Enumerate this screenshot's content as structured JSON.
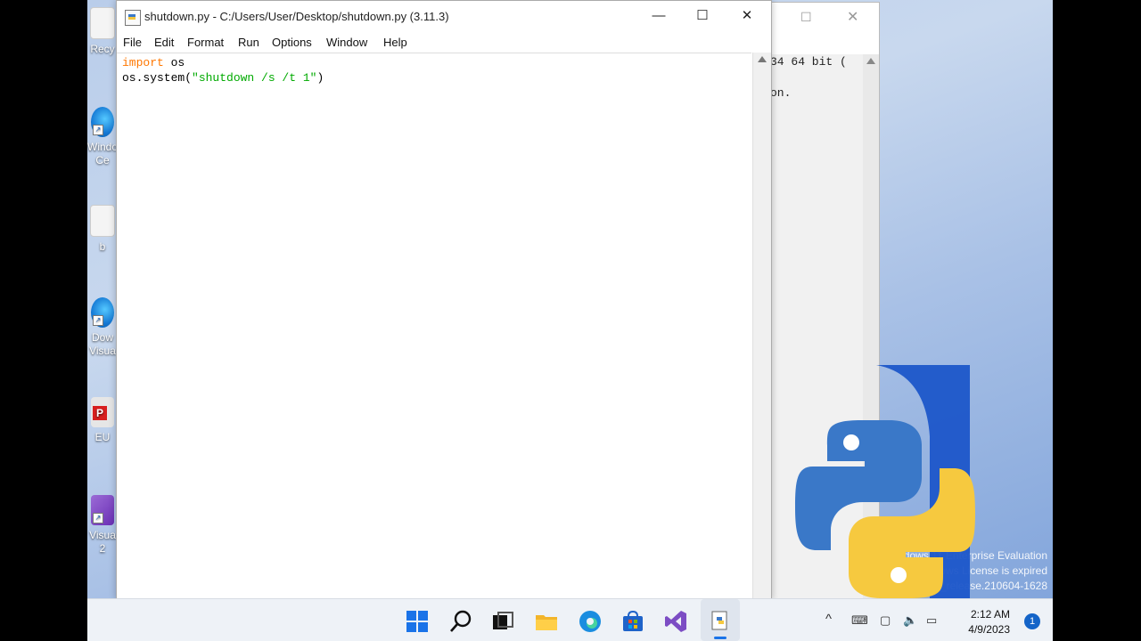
{
  "desktop": {
    "icons": [
      {
        "label1": "Recy",
        "label2": ""
      },
      {
        "label1": "Windo",
        "label2": "Ce"
      },
      {
        "label1": "b",
        "label2": ""
      },
      {
        "label1": "Dow",
        "label2": "Visua"
      },
      {
        "label1": "EU",
        "label2": ""
      },
      {
        "label1": "Visua",
        "label2": "2"
      }
    ]
  },
  "shell_window": {
    "line1": "34 64 bit (",
    "line2": "on."
  },
  "editor": {
    "title": "shutdown.py - C:/Users/User/Desktop/shutdown.py (3.11.3)",
    "menu": [
      "File",
      "Edit",
      "Format",
      "Run",
      "Options",
      "Window",
      "Help"
    ],
    "code": {
      "line1_kw": "import",
      "line1_rest": " os",
      "line2_pre": "os.system(",
      "line2_str": "\"shutdown /s /t 1\"",
      "line2_post": ")"
    }
  },
  "watermark": {
    "line1": "ndows 11 Enterprise Evaluation",
    "line2": "dows License is expired",
    "line3": ".co_release.210604-1628"
  },
  "taskbar": {
    "time": "2:12 AM",
    "date": "4/9/2023",
    "notification_count": "1",
    "icons": [
      "start-icon",
      "search-icon",
      "task-view-icon",
      "file-explorer-icon",
      "edge-icon",
      "store-icon",
      "visual-studio-icon",
      "idle-icon"
    ]
  },
  "colors": {
    "keyword": "#ff7700",
    "string": "#00aa00",
    "python_blue": "#3a78c8",
    "python_yellow": "#f6c93f"
  }
}
